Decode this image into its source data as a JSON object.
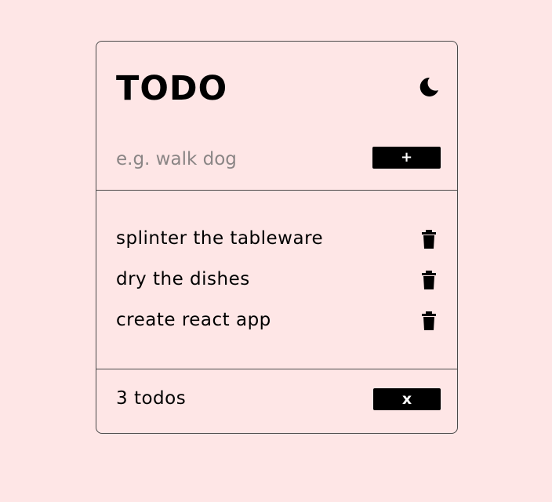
{
  "header": {
    "title": "TODO",
    "theme_icon": "moon-icon"
  },
  "new_todo": {
    "placeholder": "e.g. walk dog",
    "add_label": "+"
  },
  "todos": [
    {
      "text": "splinter the tableware",
      "icon": "trash-icon"
    },
    {
      "text": "dry the dishes",
      "icon": "trash-icon"
    },
    {
      "text": "create react app",
      "icon": "trash-icon"
    }
  ],
  "footer": {
    "count_label": "3 todos",
    "clear_label": "x"
  },
  "colors": {
    "background": "#fee6e6",
    "border": "#4a4a4a",
    "button": "#000000",
    "placeholder": "#8a8585"
  }
}
